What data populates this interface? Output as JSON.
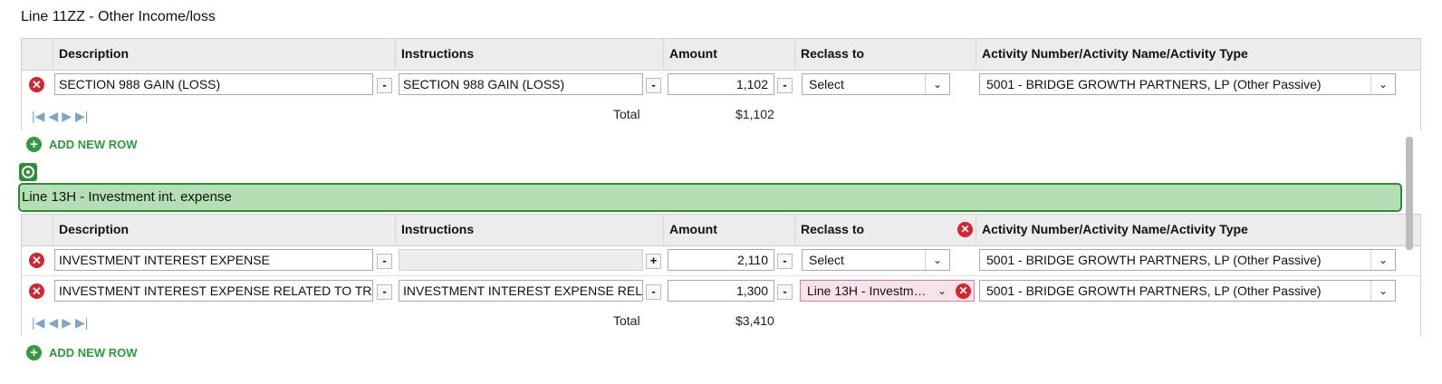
{
  "sections": [
    {
      "title": "Line 11ZZ - Other Income/loss",
      "columns": {
        "description": "Description",
        "instructions": "Instructions",
        "amount": "Amount",
        "reclass_to": "Reclass to",
        "activity": "Activity Number/Activity Name/Activity Type"
      },
      "rows": [
        {
          "description": "SECTION 988 GAIN (LOSS)",
          "desc_btn": "-",
          "instructions": "SECTION 988 GAIN (LOSS)",
          "instr_btn": "-",
          "amount": "1,102",
          "amount_btn": "-",
          "reclass": "Select",
          "activity": "5001 - BRIDGE GROWTH PARTNERS, LP (Other Passive)"
        }
      ],
      "total_label": "Total",
      "total_value": "$1,102",
      "add_row_label": "ADD NEW ROW"
    },
    {
      "title": "Line 13H - Investment int. expense",
      "columns": {
        "description": "Description",
        "instructions": "Instructions",
        "amount": "Amount",
        "reclass_to": "Reclass to",
        "activity": "Activity Number/Activity Name/Activity Type"
      },
      "rows": [
        {
          "description": "INVESTMENT INTEREST EXPENSE",
          "desc_btn": "-",
          "instructions": "",
          "instr_btn": "+",
          "amount": "2,110",
          "amount_btn": "-",
          "reclass": "Select",
          "activity": "5001 - BRIDGE GROWTH PARTNERS, LP (Other Passive)"
        },
        {
          "description": "INVESTMENT INTEREST EXPENSE RELATED TO TRADING A",
          "desc_btn": "-",
          "instructions": "INVESTMENT INTEREST EXPENSE RELATED T",
          "instr_btn": "-",
          "amount": "1,300",
          "amount_btn": "-",
          "reclass": "Line 13H - Investm…",
          "activity": "5001 - BRIDGE GROWTH PARTNERS, LP (Other Passive)"
        }
      ],
      "total_label": "Total",
      "total_value": "$3,410",
      "add_row_label": "ADD NEW ROW"
    }
  ],
  "icons": {
    "delete": "remove-circle-icon",
    "add": "add-circle-icon",
    "caret": "chevron-down-icon",
    "error": "error-icon",
    "target": "target-icon",
    "pager": [
      "first-page-icon",
      "prev-page-icon",
      "next-page-icon",
      "last-page-icon"
    ]
  },
  "colors": {
    "header_bg": "#ececec",
    "banner_bg": "#b3dfb3",
    "banner_border": "#2e8b3a",
    "delete_red": "#d6252e",
    "add_green": "#2a9d3b",
    "error_field_bg": "#f8e3ea"
  }
}
